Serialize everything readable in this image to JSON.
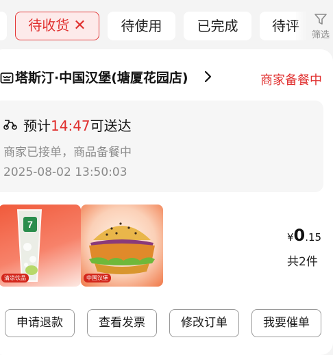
{
  "filter_tabs": {
    "active": {
      "label": "待收货",
      "close_symbol": "✕"
    },
    "tabs": [
      {
        "label": "待使用"
      },
      {
        "label": "已完成"
      },
      {
        "label": "待评"
      }
    ],
    "filter_label": "筛选"
  },
  "order": {
    "store_name": "塔斯汀·中国汉堡(塘厦花园店)",
    "status": "商家备餐中",
    "eta": {
      "prefix": "预计",
      "time": "14:47",
      "suffix": "可送达",
      "accent_color": "#e0302f"
    },
    "progress_text": "商家已接单，商品备餐中",
    "order_time": "2025-08-02 13:50:03",
    "items": [
      {
        "icon": "drink-cup-icon",
        "tag": "清凉饮品"
      },
      {
        "icon": "burger-icon",
        "tag": "中国汉堡"
      }
    ],
    "price": {
      "currency": "¥",
      "integer": "0",
      "decimal": ".15"
    },
    "quantity_text": "共2件",
    "actions": [
      {
        "label": "申请退款"
      },
      {
        "label": "查看发票"
      },
      {
        "label": "修改订单"
      },
      {
        "label": "我要催单"
      }
    ]
  }
}
